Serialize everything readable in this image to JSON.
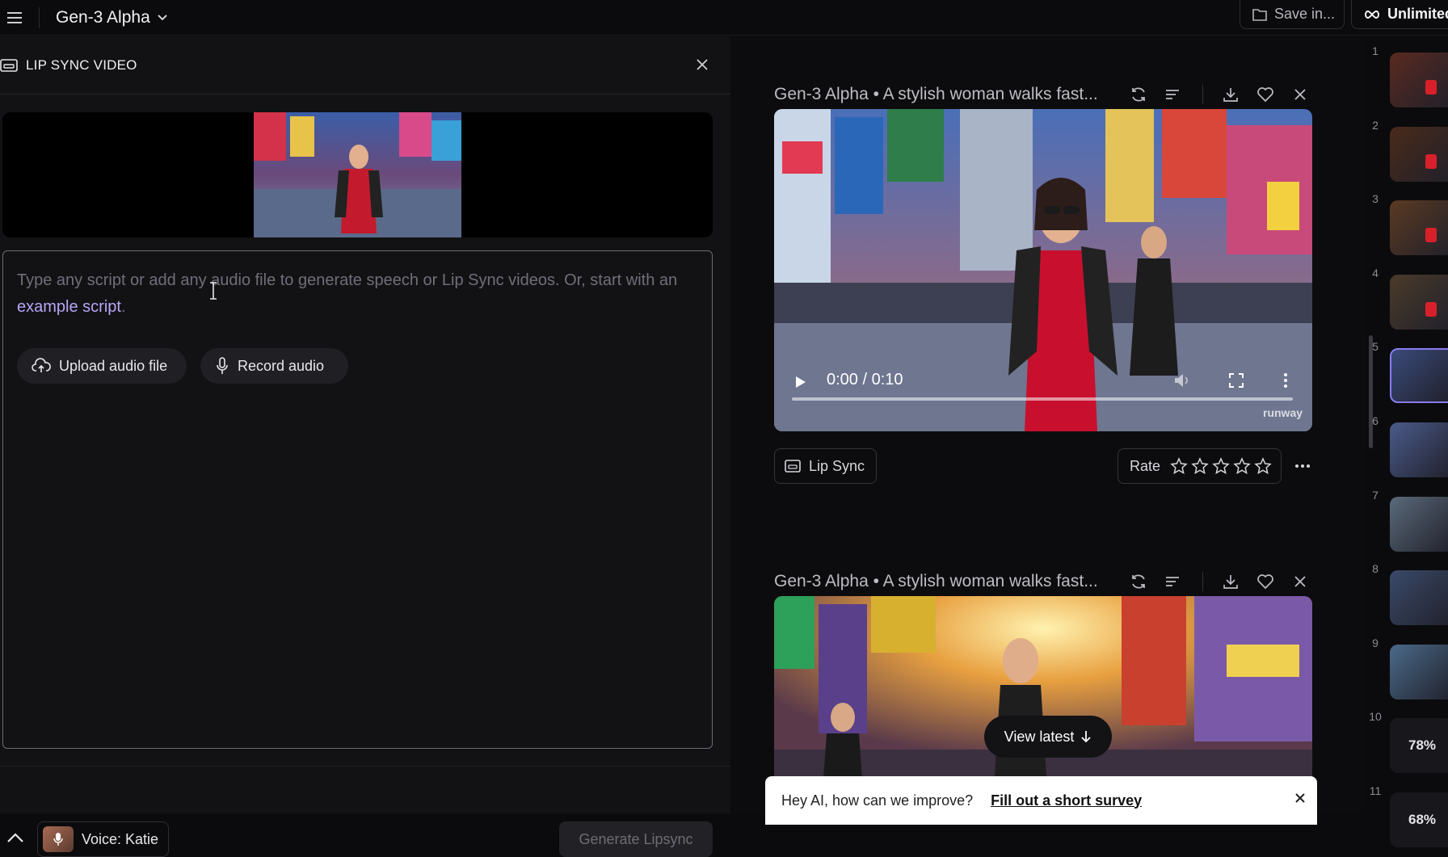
{
  "topbar": {
    "model_name": "Gen-3 Alpha",
    "save_label": "Save in...",
    "plan_label": "Unlimited"
  },
  "left_panel": {
    "title": "LIP SYNC VIDEO",
    "placeholder_text": "Type any script or add any audio file to generate speech or Lip Sync videos. Or, start with an ",
    "example_link": "example script",
    "placeholder_end": ".",
    "upload_label": "Upload audio file",
    "record_label": "Record audio",
    "voice_label": "Voice: Katie",
    "generate_label": "Generate Lipsync"
  },
  "generations": [
    {
      "title": "Gen-3 Alpha • A stylish woman walks fast...",
      "time": "0:00 / 0:10",
      "watermark": "runway",
      "lipsync_label": "Lip Sync",
      "rate_label": "Rate"
    },
    {
      "title": "Gen-3 Alpha • A stylish woman walks fast..."
    }
  ],
  "view_latest_label": "View latest",
  "survey": {
    "text": "Hey AI, how can we improve?",
    "link": "Fill out a short survey"
  },
  "rail": {
    "items": [
      {
        "num": "1"
      },
      {
        "num": "2"
      },
      {
        "num": "3"
      },
      {
        "num": "4"
      },
      {
        "num": "5"
      },
      {
        "num": "6"
      },
      {
        "num": "7"
      },
      {
        "num": "8"
      },
      {
        "num": "9"
      },
      {
        "num": "10",
        "progress": "78%"
      },
      {
        "num": "11",
        "progress": "68%"
      }
    ]
  },
  "colors": {
    "accent": "#8b7cf0",
    "link": "#b7a6f5",
    "background": "#0b0b0d"
  }
}
